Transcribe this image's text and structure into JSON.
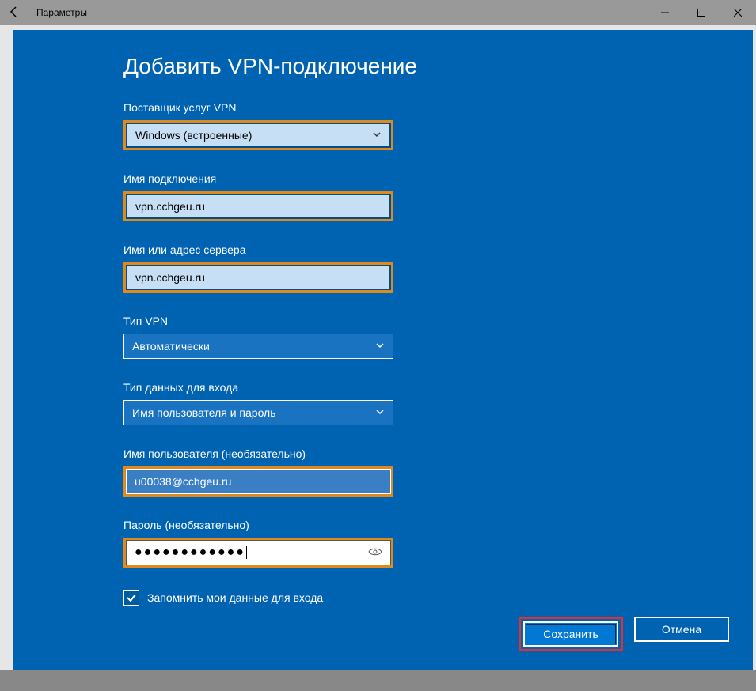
{
  "titlebar": {
    "label": "Параметры"
  },
  "modal": {
    "title": "Добавить VPN-подключение",
    "provider": {
      "label": "Поставщик услуг VPN",
      "value": "Windows (встроенные)"
    },
    "conn_name": {
      "label": "Имя подключения",
      "value": "vpn.cchgeu.ru"
    },
    "server": {
      "label": "Имя или адрес сервера",
      "value": "vpn.cchgeu.ru"
    },
    "vpn_type": {
      "label": "Тип VPN",
      "value": "Автоматически"
    },
    "signin_type": {
      "label": "Тип данных для входа",
      "value": "Имя пользователя и пароль"
    },
    "username": {
      "label": "Имя пользователя (необязательно)",
      "value": "u00038@cchgeu.ru"
    },
    "password": {
      "label": "Пароль (необязательно)",
      "value": "●●●●●●●●●●●●"
    },
    "remember": {
      "label": "Запомнить мои данные для входа",
      "checked": true
    },
    "save_btn": "Сохранить",
    "cancel_btn": "Отмена"
  }
}
